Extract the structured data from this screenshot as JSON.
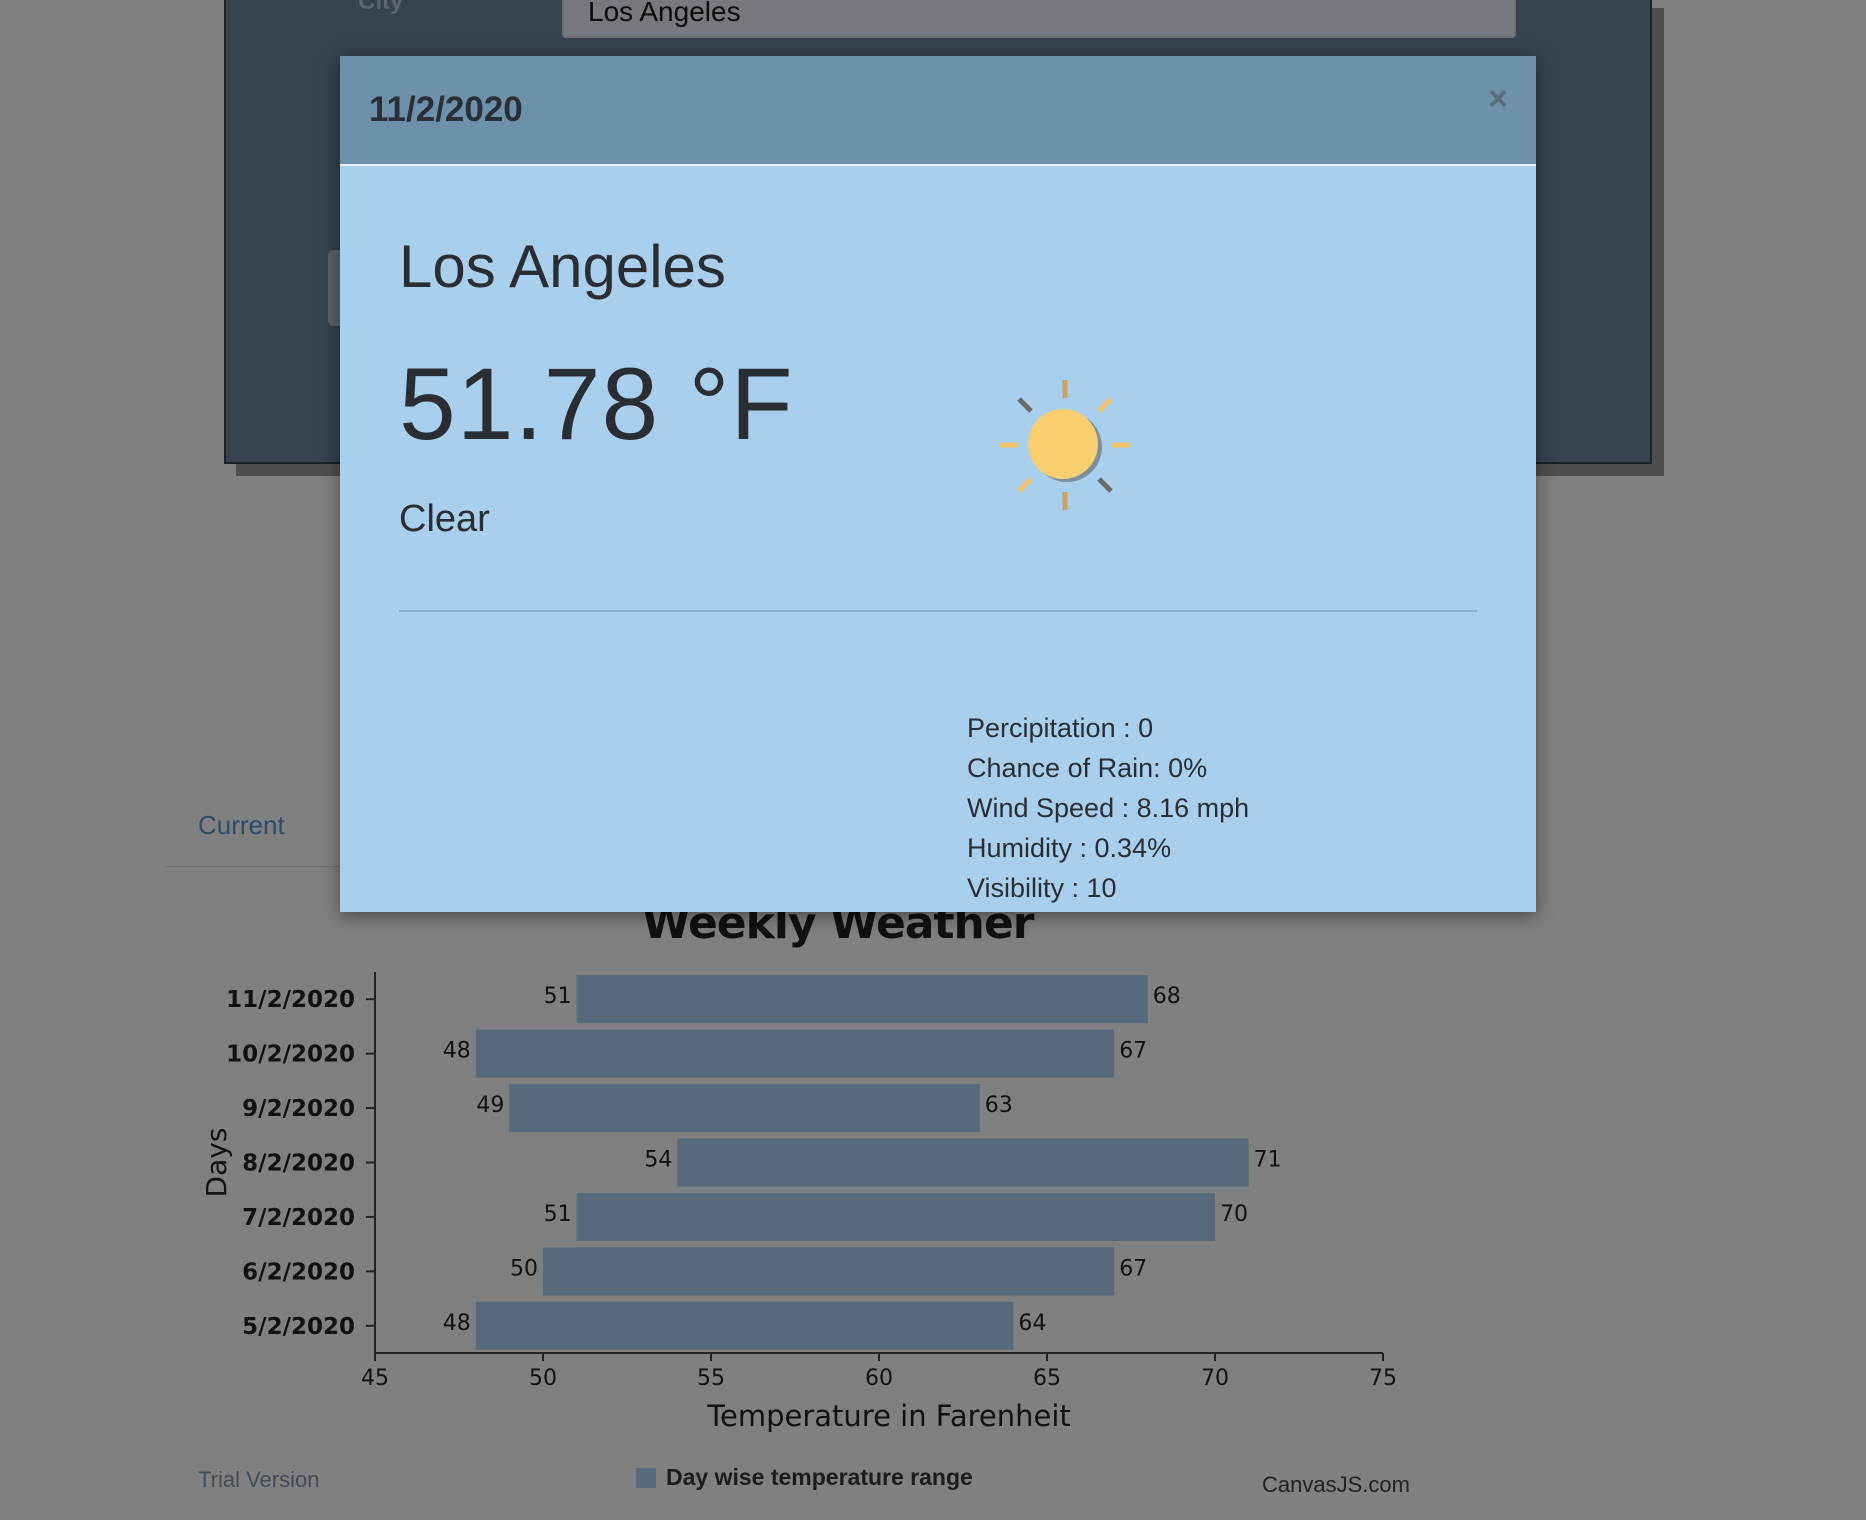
{
  "background_form": {
    "city_label": "City",
    "city_value": "Los Angeles"
  },
  "tabs": {
    "current_label": "Current"
  },
  "modal": {
    "date": "11/2/2020",
    "close_icon": "close-icon",
    "city": "Los Angeles",
    "temperature": "51.78 °F",
    "condition": "Clear",
    "weather_icon": "sun-icon",
    "details": [
      "Percipitation : 0",
      "Chance of Rain: 0%",
      "Wind Speed : 8.16 mph",
      "Humidity : 0.34%",
      "Visibility : 10"
    ]
  },
  "chart_data": {
    "type": "bar",
    "orientation": "horizontal-range",
    "title": "Weekly Weather",
    "xlabel": "Temperature in Farenheit",
    "ylabel": "Days",
    "xlim": [
      45,
      75
    ],
    "xticks": [
      45,
      50,
      55,
      60,
      65,
      70,
      75
    ],
    "categories": [
      "11/2/2020",
      "10/2/2020",
      "9/2/2020",
      "8/2/2020",
      "7/2/2020",
      "6/2/2020",
      "5/2/2020"
    ],
    "series": [
      {
        "name": "Day wise temperature range",
        "ranges": [
          [
            51,
            68
          ],
          [
            48,
            67
          ],
          [
            49,
            63
          ],
          [
            54,
            71
          ],
          [
            51,
            70
          ],
          [
            50,
            67
          ],
          [
            48,
            64
          ]
        ]
      }
    ],
    "bar_color": "#566a7b",
    "legend_position": "bottom"
  },
  "footer": {
    "trial_text": "Trial Version",
    "credit_text": "CanvasJS.com"
  }
}
